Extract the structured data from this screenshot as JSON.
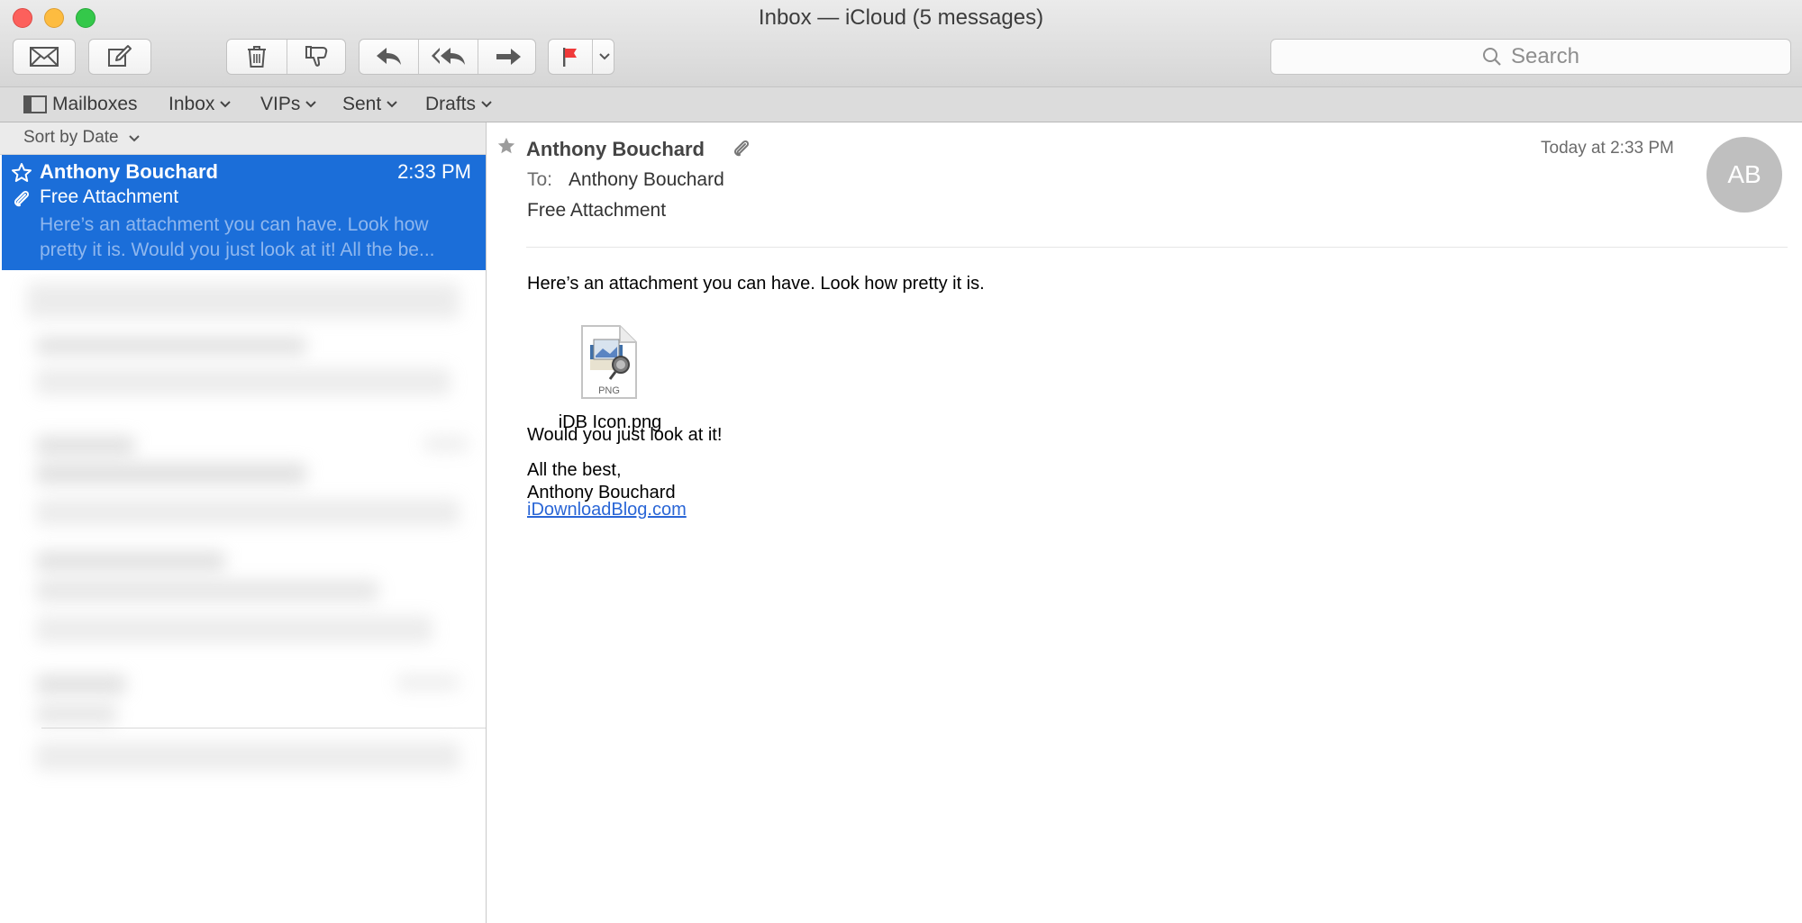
{
  "window": {
    "title": "Inbox — iCloud (5 messages)"
  },
  "toolbar": {
    "search_placeholder": "Search"
  },
  "favorites": {
    "mailboxes": "Mailboxes",
    "inbox": "Inbox",
    "vips": "VIPs",
    "sent": "Sent",
    "drafts": "Drafts"
  },
  "message_list": {
    "sort_label": "Sort by Date",
    "selected": {
      "sender": "Anthony Bouchard",
      "time": "2:33 PM",
      "subject": "Free Attachment",
      "preview": "Here’s an attachment you can have. Look how pretty it is. Would you just look at it! All the be..."
    }
  },
  "message": {
    "from": "Anthony Bouchard",
    "date": "Today at 2:33 PM",
    "avatar_initials": "AB",
    "to_label": "To:",
    "to": "Anthony Bouchard",
    "subject": "Free Attachment",
    "line1": "Here’s an attachment you can have. Look how pretty it is.",
    "attachment_type": "PNG",
    "attachment_name": "iDB Icon.png",
    "line2": "Would you just look at it!",
    "signoff": "All the best,",
    "signature_name": "Anthony Bouchard",
    "link": "iDownloadBlog.com"
  },
  "colors": {
    "selection": "#1b6ed9",
    "flag": "#f03a3a",
    "link": "#2a66d6"
  }
}
